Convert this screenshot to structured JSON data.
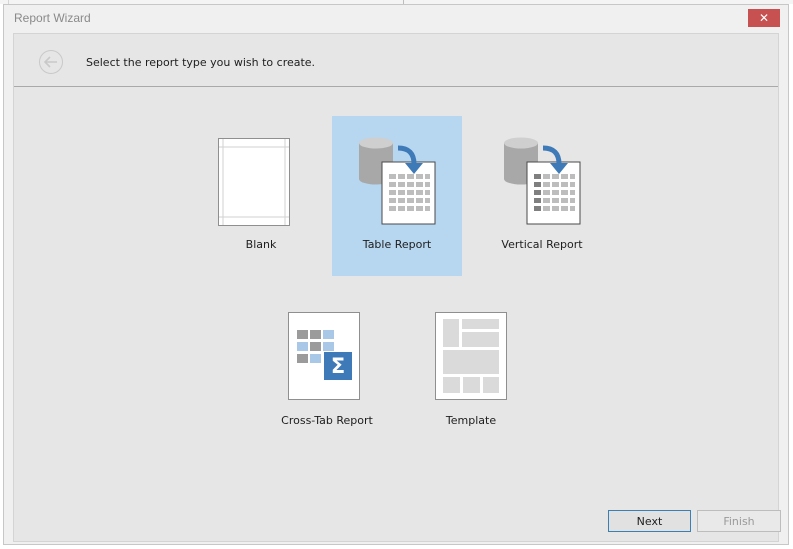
{
  "window": {
    "title": "Report Wizard",
    "close_label": "✕"
  },
  "header": {
    "instruction": "Select the report type you wish to create."
  },
  "report_types": [
    {
      "label": "Blank",
      "icon": "blank-report-icon",
      "selected": false
    },
    {
      "label": "Table Report",
      "icon": "table-report-icon",
      "selected": true
    },
    {
      "label": "Vertical Report",
      "icon": "vertical-report-icon",
      "selected": false
    },
    {
      "label": "Cross-Tab Report",
      "icon": "cross-tab-report-icon",
      "selected": false
    },
    {
      "label": "Template",
      "icon": "template-icon",
      "selected": false
    }
  ],
  "footer": {
    "next_label": "Next",
    "finish_label": "Finish",
    "finish_enabled": false
  },
  "colors": {
    "selection": "#b7d7f1",
    "accent_blue": "#3e79b8",
    "close_red": "#c75050"
  }
}
